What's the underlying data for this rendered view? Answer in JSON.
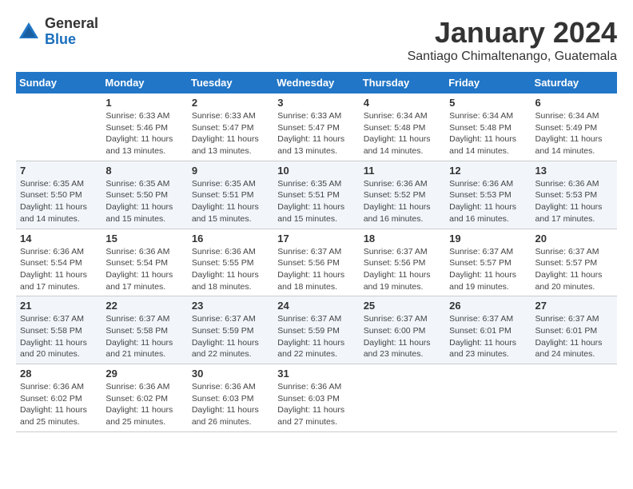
{
  "header": {
    "logo": {
      "general": "General",
      "blue": "Blue"
    },
    "title": "January 2024",
    "subtitle": "Santiago Chimaltenango, Guatemala"
  },
  "weekdays": [
    "Sunday",
    "Monday",
    "Tuesday",
    "Wednesday",
    "Thursday",
    "Friday",
    "Saturday"
  ],
  "weeks": [
    [
      {
        "day": "",
        "sunrise": "",
        "sunset": "",
        "daylight": ""
      },
      {
        "day": "1",
        "sunrise": "Sunrise: 6:33 AM",
        "sunset": "Sunset: 5:46 PM",
        "daylight": "Daylight: 11 hours and 13 minutes."
      },
      {
        "day": "2",
        "sunrise": "Sunrise: 6:33 AM",
        "sunset": "Sunset: 5:47 PM",
        "daylight": "Daylight: 11 hours and 13 minutes."
      },
      {
        "day": "3",
        "sunrise": "Sunrise: 6:33 AM",
        "sunset": "Sunset: 5:47 PM",
        "daylight": "Daylight: 11 hours and 13 minutes."
      },
      {
        "day": "4",
        "sunrise": "Sunrise: 6:34 AM",
        "sunset": "Sunset: 5:48 PM",
        "daylight": "Daylight: 11 hours and 14 minutes."
      },
      {
        "day": "5",
        "sunrise": "Sunrise: 6:34 AM",
        "sunset": "Sunset: 5:48 PM",
        "daylight": "Daylight: 11 hours and 14 minutes."
      },
      {
        "day": "6",
        "sunrise": "Sunrise: 6:34 AM",
        "sunset": "Sunset: 5:49 PM",
        "daylight": "Daylight: 11 hours and 14 minutes."
      }
    ],
    [
      {
        "day": "7",
        "sunrise": "Sunrise: 6:35 AM",
        "sunset": "Sunset: 5:50 PM",
        "daylight": "Daylight: 11 hours and 14 minutes."
      },
      {
        "day": "8",
        "sunrise": "Sunrise: 6:35 AM",
        "sunset": "Sunset: 5:50 PM",
        "daylight": "Daylight: 11 hours and 15 minutes."
      },
      {
        "day": "9",
        "sunrise": "Sunrise: 6:35 AM",
        "sunset": "Sunset: 5:51 PM",
        "daylight": "Daylight: 11 hours and 15 minutes."
      },
      {
        "day": "10",
        "sunrise": "Sunrise: 6:35 AM",
        "sunset": "Sunset: 5:51 PM",
        "daylight": "Daylight: 11 hours and 15 minutes."
      },
      {
        "day": "11",
        "sunrise": "Sunrise: 6:36 AM",
        "sunset": "Sunset: 5:52 PM",
        "daylight": "Daylight: 11 hours and 16 minutes."
      },
      {
        "day": "12",
        "sunrise": "Sunrise: 6:36 AM",
        "sunset": "Sunset: 5:53 PM",
        "daylight": "Daylight: 11 hours and 16 minutes."
      },
      {
        "day": "13",
        "sunrise": "Sunrise: 6:36 AM",
        "sunset": "Sunset: 5:53 PM",
        "daylight": "Daylight: 11 hours and 17 minutes."
      }
    ],
    [
      {
        "day": "14",
        "sunrise": "Sunrise: 6:36 AM",
        "sunset": "Sunset: 5:54 PM",
        "daylight": "Daylight: 11 hours and 17 minutes."
      },
      {
        "day": "15",
        "sunrise": "Sunrise: 6:36 AM",
        "sunset": "Sunset: 5:54 PM",
        "daylight": "Daylight: 11 hours and 17 minutes."
      },
      {
        "day": "16",
        "sunrise": "Sunrise: 6:36 AM",
        "sunset": "Sunset: 5:55 PM",
        "daylight": "Daylight: 11 hours and 18 minutes."
      },
      {
        "day": "17",
        "sunrise": "Sunrise: 6:37 AM",
        "sunset": "Sunset: 5:56 PM",
        "daylight": "Daylight: 11 hours and 18 minutes."
      },
      {
        "day": "18",
        "sunrise": "Sunrise: 6:37 AM",
        "sunset": "Sunset: 5:56 PM",
        "daylight": "Daylight: 11 hours and 19 minutes."
      },
      {
        "day": "19",
        "sunrise": "Sunrise: 6:37 AM",
        "sunset": "Sunset: 5:57 PM",
        "daylight": "Daylight: 11 hours and 19 minutes."
      },
      {
        "day": "20",
        "sunrise": "Sunrise: 6:37 AM",
        "sunset": "Sunset: 5:57 PM",
        "daylight": "Daylight: 11 hours and 20 minutes."
      }
    ],
    [
      {
        "day": "21",
        "sunrise": "Sunrise: 6:37 AM",
        "sunset": "Sunset: 5:58 PM",
        "daylight": "Daylight: 11 hours and 20 minutes."
      },
      {
        "day": "22",
        "sunrise": "Sunrise: 6:37 AM",
        "sunset": "Sunset: 5:58 PM",
        "daylight": "Daylight: 11 hours and 21 minutes."
      },
      {
        "day": "23",
        "sunrise": "Sunrise: 6:37 AM",
        "sunset": "Sunset: 5:59 PM",
        "daylight": "Daylight: 11 hours and 22 minutes."
      },
      {
        "day": "24",
        "sunrise": "Sunrise: 6:37 AM",
        "sunset": "Sunset: 5:59 PM",
        "daylight": "Daylight: 11 hours and 22 minutes."
      },
      {
        "day": "25",
        "sunrise": "Sunrise: 6:37 AM",
        "sunset": "Sunset: 6:00 PM",
        "daylight": "Daylight: 11 hours and 23 minutes."
      },
      {
        "day": "26",
        "sunrise": "Sunrise: 6:37 AM",
        "sunset": "Sunset: 6:01 PM",
        "daylight": "Daylight: 11 hours and 23 minutes."
      },
      {
        "day": "27",
        "sunrise": "Sunrise: 6:37 AM",
        "sunset": "Sunset: 6:01 PM",
        "daylight": "Daylight: 11 hours and 24 minutes."
      }
    ],
    [
      {
        "day": "28",
        "sunrise": "Sunrise: 6:36 AM",
        "sunset": "Sunset: 6:02 PM",
        "daylight": "Daylight: 11 hours and 25 minutes."
      },
      {
        "day": "29",
        "sunrise": "Sunrise: 6:36 AM",
        "sunset": "Sunset: 6:02 PM",
        "daylight": "Daylight: 11 hours and 25 minutes."
      },
      {
        "day": "30",
        "sunrise": "Sunrise: 6:36 AM",
        "sunset": "Sunset: 6:03 PM",
        "daylight": "Daylight: 11 hours and 26 minutes."
      },
      {
        "day": "31",
        "sunrise": "Sunrise: 6:36 AM",
        "sunset": "Sunset: 6:03 PM",
        "daylight": "Daylight: 11 hours and 27 minutes."
      },
      {
        "day": "",
        "sunrise": "",
        "sunset": "",
        "daylight": ""
      },
      {
        "day": "",
        "sunrise": "",
        "sunset": "",
        "daylight": ""
      },
      {
        "day": "",
        "sunrise": "",
        "sunset": "",
        "daylight": ""
      }
    ]
  ]
}
